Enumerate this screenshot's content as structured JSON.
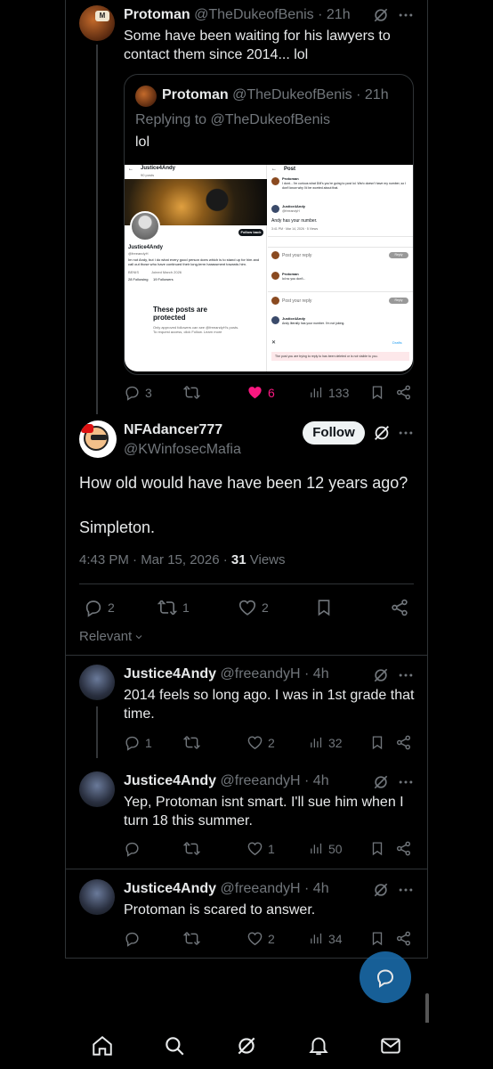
{
  "tweet1": {
    "name": "Protoman",
    "handle": "@TheDukeofBenis",
    "time": "21h",
    "text_line1": "Some have been waiting for his lawyers to",
    "text_line2": "contact them since 2014... lol",
    "quote": {
      "name": "Protoman",
      "handle": "@TheDukeofBenis",
      "time": "21h",
      "replying": "Replying to @TheDukeofBenis",
      "text": "lol",
      "shot_left": {
        "title": "Justice4Andy",
        "posts": "90 posts",
        "follow_back": "Follow back",
        "name": "Justice4Andy",
        "handle": "@freeandyH",
        "follows": "Follows you",
        "bio": "Im not Andy, but i do what every good person does which is to stand up for him and call out those who have continued their long-term harassment towards him.",
        "loc": "BENIS",
        "joined": "Joined March 2026",
        "following": "28 Following",
        "followers": "19 Followers",
        "protected_title": "These posts are protected",
        "protected_text": "Only approved followers can see @freeandyH's posts. To request access, click Follow. Learn more"
      },
      "shot_right": {
        "title": "Post",
        "p1_name": "Protoman",
        "p1_text": "I dont... I'm curious what DM's you're going to post lol. We/o doesn't have my number, so I don't know why I'd be worried about that.",
        "p2_name": "Justice4Andy",
        "p2_handle": "@freeandyH",
        "p2_text": "Andy has your number.",
        "p2_meta": "3:41 PM · Mar 14, 2026 · 5 Views",
        "reply_placeholder": "Post your reply",
        "reply_btn": "Reply",
        "p3_name": "Protoman",
        "p3_text": "lol no you don't...",
        "p4_name": "Justice4Andy",
        "p4_text": "Andy literally has your number. I'm not joking.",
        "draft": "Drafts",
        "deleted": "The post you are trying to reply to has been deleted or is not visible to you."
      }
    },
    "stats": {
      "replies": "3",
      "retweets": "",
      "likes": "6",
      "views": "133"
    }
  },
  "main_tweet": {
    "name": "NFAdancer777",
    "handle": "@KWinfosecMafia",
    "follow_label": "Follow",
    "text_line1": "How old would have have been 12 years ago?",
    "text_line2": "Simpleton.",
    "timestamp": "4:43 PM · Mar 15, 2026 · ",
    "views_count": "31",
    "views_label": " Views",
    "stats": {
      "replies": "2",
      "retweets": "1",
      "likes": "2"
    }
  },
  "sort_label": "Relevant",
  "replies": [
    {
      "name": "Justice4Andy",
      "handle": "@freeandyH",
      "time": "4h",
      "text_line1": "2014 feels so long ago. I was in 1st grade that",
      "text_line2": "time.",
      "stats": {
        "replies": "1",
        "retweets": "",
        "likes": "2",
        "views": "32"
      }
    },
    {
      "name": "Justice4Andy",
      "handle": "@freeandyH",
      "time": "4h",
      "text_line1": "Yep, Protoman isnt smart. I'll sue him when I",
      "text_line2": "turn 18 this summer.",
      "stats": {
        "replies": "",
        "retweets": "",
        "likes": "1",
        "views": "50"
      }
    },
    {
      "name": "Justice4Andy",
      "handle": "@freeandyH",
      "time": "4h",
      "text_line1": "Protoman is scared to answer.",
      "text_line2": "",
      "stats": {
        "replies": "",
        "retweets": "",
        "likes": "2",
        "views": "34"
      }
    }
  ],
  "colors": {
    "accent": "#1d9bf0",
    "like": "#f91880",
    "fab": "#1a6aa8",
    "bg": "#000000",
    "text": "#e7e9ea",
    "muted": "#71767b"
  }
}
